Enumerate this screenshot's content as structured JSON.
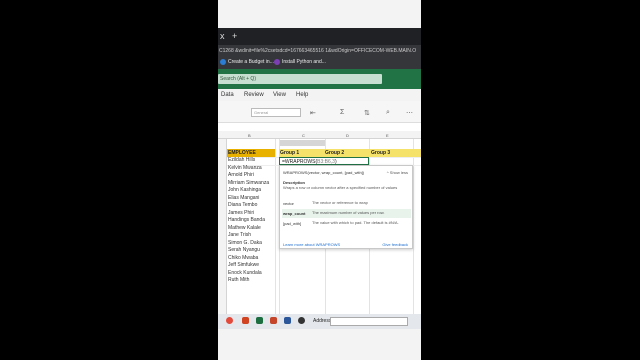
{
  "browser": {
    "tab_close": "x",
    "new_tab": "+",
    "url_text": "C1268 &wdinit=file%2csetsdcd=167663465516 1&wdOrigin=OFFICECOM-WEB.MAIN.O",
    "bookmarks": [
      {
        "label": "Create a Budget in...",
        "color": "#2b7cd3"
      },
      {
        "label": "Install Python and...",
        "color": "#7b3fb3"
      }
    ]
  },
  "search": {
    "placeholder": "Search (Alt + Q)"
  },
  "menu": {
    "items": [
      "Data",
      "Review",
      "View",
      "Help"
    ]
  },
  "ribbon": {
    "number_format": "General",
    "sum_symbol": "Σ"
  },
  "grid": {
    "column_headers": [
      "B",
      "C",
      "D",
      "E"
    ],
    "employee_header": "EMPLOYEE",
    "employees": [
      "Ezildah Hills",
      "Kelvin Mwanza",
      "Arnold Phiri",
      "Mirriam Simwanza",
      "John Kashinga",
      "Elias Mangani",
      "Diana Tembo",
      "James Phiri",
      "Handings Banda",
      "Mathew Kalale",
      "Jane Trish",
      "Simon G. Daka",
      "Serah Nyangu",
      "Chiko Mwaba",
      "Jeff Simfukwe",
      "Enock Kundala",
      "Ruth Mith"
    ],
    "groups": [
      "Group 1",
      "Group 2",
      "Group 3"
    ],
    "formula_prefix": "=WRAPROWS(",
    "formula_args": "B3:B6,3",
    "formula_suffix": ")"
  },
  "tooltip": {
    "signature": "WRAPROWS(vector, wrap_count, [pad_with])",
    "show_less": "^  Show less",
    "description_heading": "Description",
    "description": "Wraps a row or column vector after a specified number of values",
    "params": [
      {
        "name": "vector",
        "desc": "The vector or reference to wrap"
      },
      {
        "name": "wrap_count",
        "desc": "The maximum number of values per row."
      },
      {
        "name": "[pad_with]",
        "desc": "The value with which to pad. The default is #N/A."
      }
    ],
    "learn_more": "Learn more about WRAPROWS",
    "feedback": "Give feedback"
  },
  "taskbar": {
    "icons": [
      {
        "name": "chrome-icon",
        "color": "#e34a3b"
      },
      {
        "name": "office-icon",
        "color": "#d04423"
      },
      {
        "name": "excel-icon",
        "color": "#1d6f42"
      },
      {
        "name": "powerpoint-icon",
        "color": "#c4452a"
      },
      {
        "name": "word-icon",
        "color": "#2b579a"
      },
      {
        "name": "windows-icon",
        "color": "#333333"
      }
    ],
    "address_label": "Address"
  },
  "colors": {
    "excel_green": "#217346",
    "employee_header": "#e8b100",
    "group_header": "#f5e26a"
  }
}
